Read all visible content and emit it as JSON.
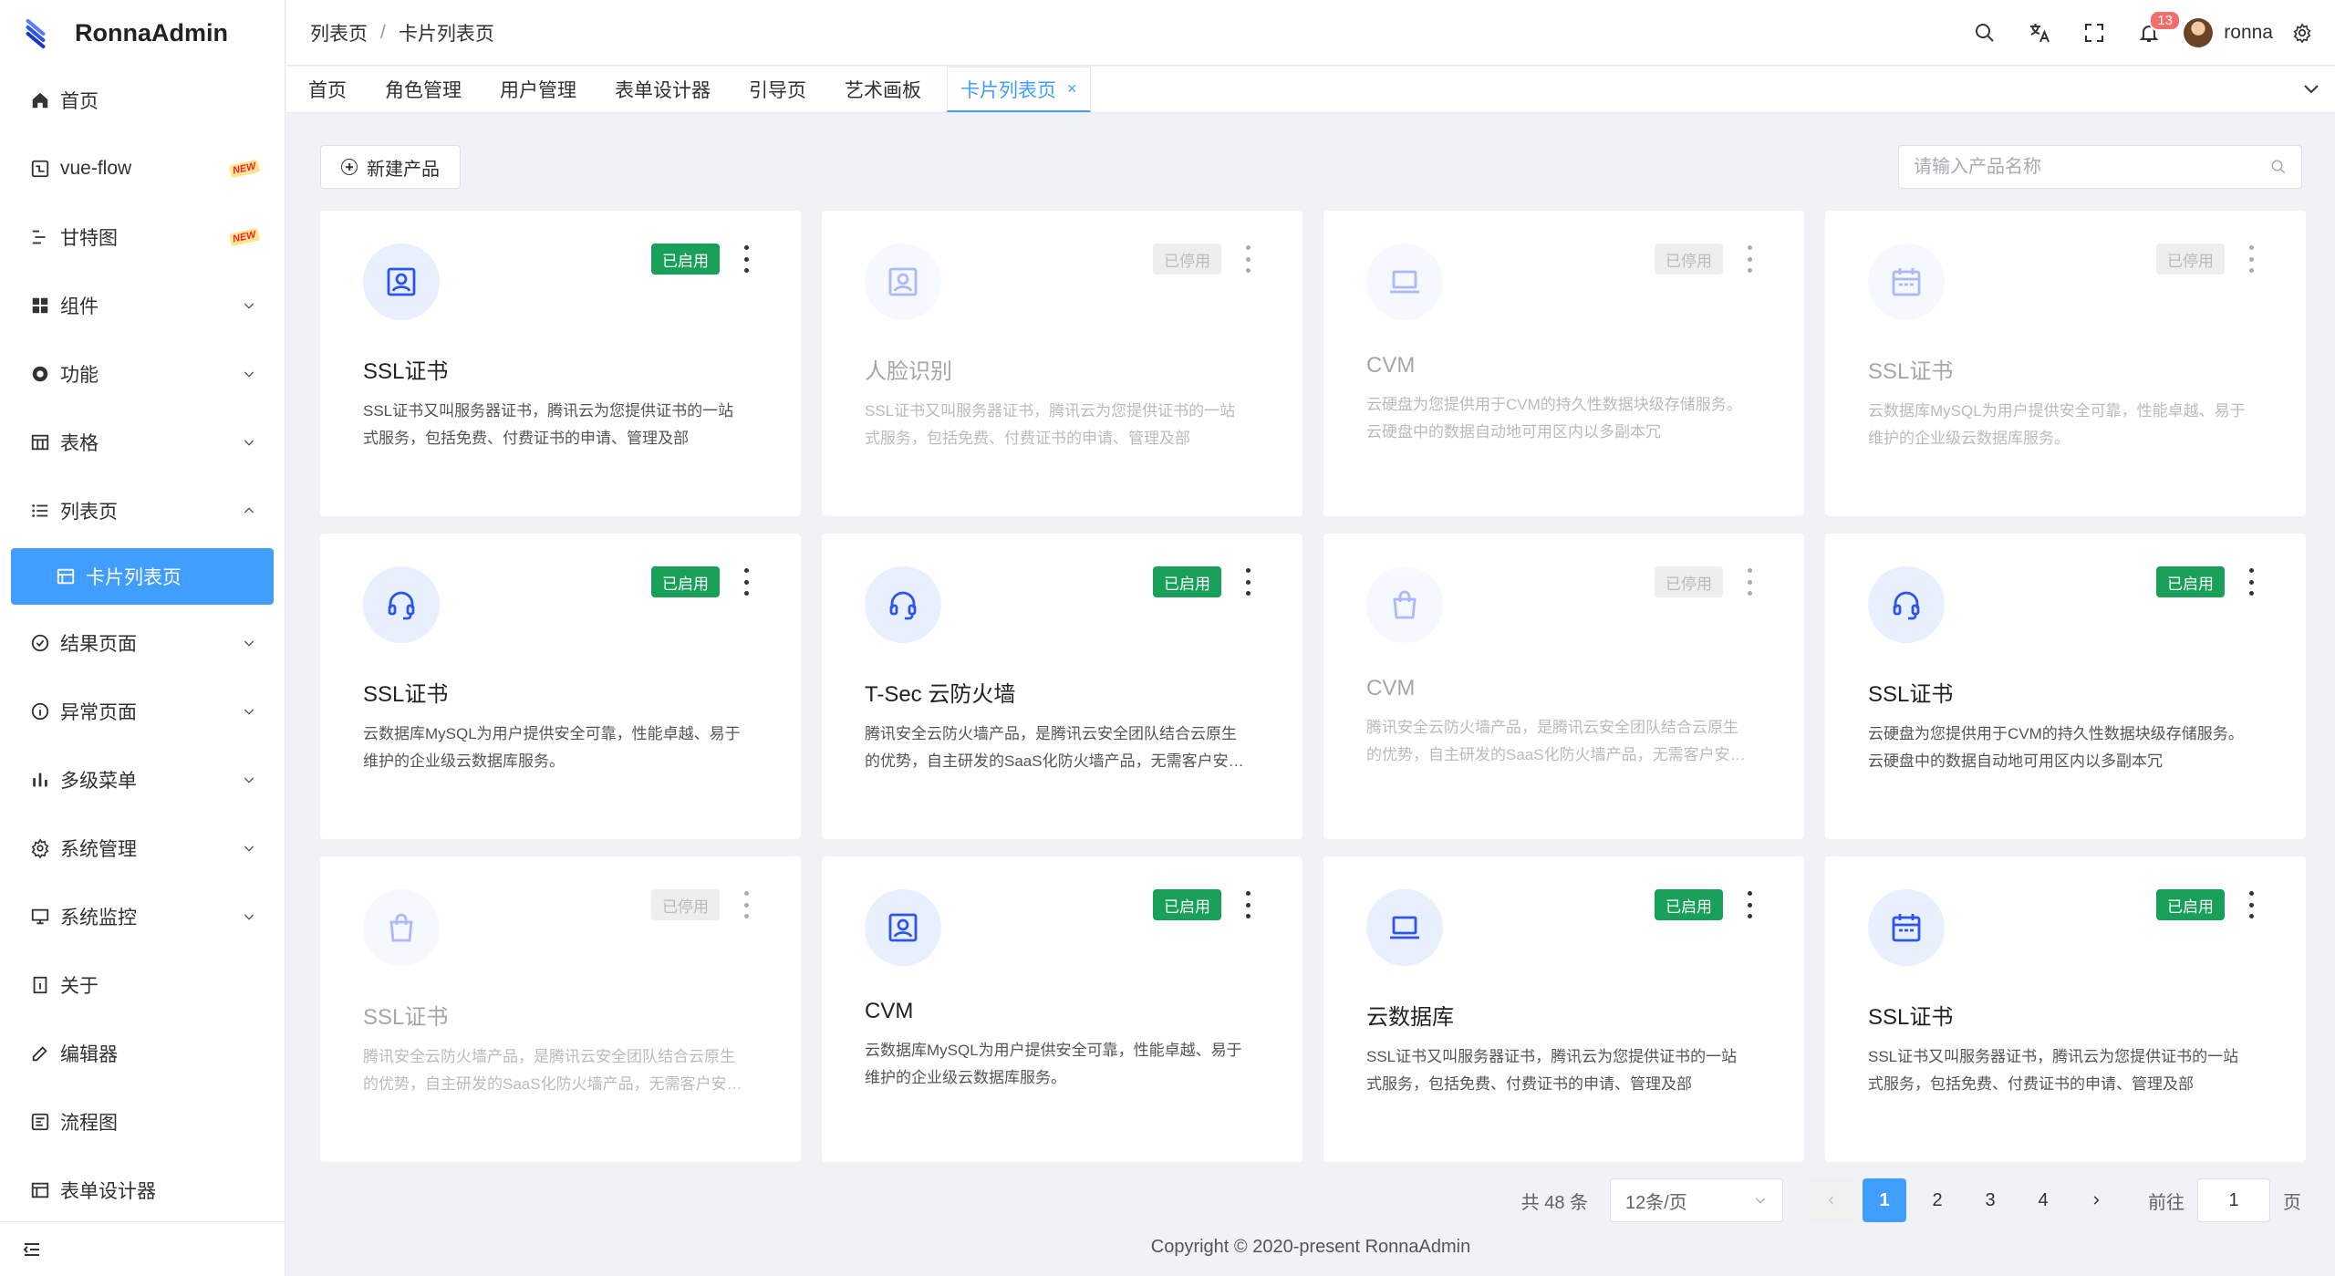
{
  "app": {
    "name": "RonnaAdmin"
  },
  "sidebar": {
    "items": [
      {
        "label": "首页",
        "icon": "home-icon",
        "arrow": ""
      },
      {
        "label": "vue-flow",
        "icon": "flow-icon",
        "badge": "NEW",
        "arrow": ""
      },
      {
        "label": "甘特图",
        "icon": "gantt-icon",
        "badge": "NEW",
        "arrow": ""
      },
      {
        "label": "组件",
        "icon": "grid-icon",
        "arrow": "down"
      },
      {
        "label": "功能",
        "icon": "function-icon",
        "arrow": "down"
      },
      {
        "label": "表格",
        "icon": "table-icon",
        "arrow": "down"
      },
      {
        "label": "列表页",
        "icon": "list-icon",
        "arrow": "up"
      },
      {
        "label": "卡片列表页",
        "icon": "card-icon",
        "active": true
      },
      {
        "label": "结果页面",
        "icon": "check-circle-icon",
        "arrow": "down"
      },
      {
        "label": "异常页面",
        "icon": "info-icon",
        "arrow": "down"
      },
      {
        "label": "多级菜单",
        "icon": "bar-chart-icon",
        "arrow": "down"
      },
      {
        "label": "系统管理",
        "icon": "settings-icon",
        "arrow": "down"
      },
      {
        "label": "系统监控",
        "icon": "monitor-icon",
        "arrow": "down"
      },
      {
        "label": "关于",
        "icon": "about-icon",
        "arrow": ""
      },
      {
        "label": "编辑器",
        "icon": "edit-icon",
        "arrow": ""
      },
      {
        "label": "流程图",
        "icon": "flowchart-icon",
        "arrow": ""
      },
      {
        "label": "表单设计器",
        "icon": "form-icon",
        "arrow": ""
      }
    ]
  },
  "header": {
    "breadcrumb": [
      "列表页",
      "卡片列表页"
    ],
    "notifications": "13",
    "username": "ronna"
  },
  "tabs": [
    {
      "label": "首页"
    },
    {
      "label": "角色管理"
    },
    {
      "label": "用户管理"
    },
    {
      "label": "表单设计器"
    },
    {
      "label": "引导页"
    },
    {
      "label": "艺术画板"
    },
    {
      "label": "卡片列表页",
      "active": true
    }
  ],
  "toolbar": {
    "new_label": "新建产品",
    "search_placeholder": "请输入产品名称"
  },
  "cards": [
    {
      "title": "SSL证书",
      "desc": "SSL证书又叫服务器证书，腾讯云为您提供证书的一站式服务，包括免费、付费证书的申请、管理及部",
      "status": "已启用",
      "enabled": true,
      "icon": "person-card-icon"
    },
    {
      "title": "人脸识别",
      "desc": "SSL证书又叫服务器证书，腾讯云为您提供证书的一站式服务，包括免费、付费证书的申请、管理及部",
      "status": "已停用",
      "enabled": false,
      "icon": "person-card-icon"
    },
    {
      "title": "CVM",
      "desc": "云硬盘为您提供用于CVM的持久性数据块级存储服务。云硬盘中的数据自动地可用区内以多副本冗",
      "status": "已停用",
      "enabled": false,
      "icon": "laptop-icon"
    },
    {
      "title": "SSL证书",
      "desc": "云数据库MySQL为用户提供安全可靠，性能卓越、易于维护的企业级云数据库服务。",
      "status": "已停用",
      "enabled": false,
      "icon": "calendar-icon"
    },
    {
      "title": "SSL证书",
      "desc": "云数据库MySQL为用户提供安全可靠，性能卓越、易于维护的企业级云数据库服务。",
      "status": "已启用",
      "enabled": true,
      "icon": "headset-icon"
    },
    {
      "title": "T-Sec 云防火墙",
      "desc": "腾讯安全云防火墙产品，是腾讯云安全团队结合云原生的优势，自主研发的SaaS化防火墙产品，无需客户安装部署",
      "status": "已启用",
      "enabled": true,
      "icon": "headset-icon"
    },
    {
      "title": "CVM",
      "desc": "腾讯安全云防火墙产品，是腾讯云安全团队结合云原生的优势，自主研发的SaaS化防火墙产品，无需客户安装部署",
      "status": "已停用",
      "enabled": false,
      "icon": "shopping-bag-icon"
    },
    {
      "title": "SSL证书",
      "desc": "云硬盘为您提供用于CVM的持久性数据块级存储服务。云硬盘中的数据自动地可用区内以多副本冗",
      "status": "已启用",
      "enabled": true,
      "icon": "headset-icon"
    },
    {
      "title": "SSL证书",
      "desc": "腾讯安全云防火墙产品，是腾讯云安全团队结合云原生的优势，自主研发的SaaS化防火墙产品，无需客户安装部署",
      "status": "已停用",
      "enabled": false,
      "icon": "shopping-bag-icon"
    },
    {
      "title": "CVM",
      "desc": "云数据库MySQL为用户提供安全可靠，性能卓越、易于维护的企业级云数据库服务。",
      "status": "已启用",
      "enabled": true,
      "icon": "person-card-icon"
    },
    {
      "title": "云数据库",
      "desc": "SSL证书又叫服务器证书，腾讯云为您提供证书的一站式服务，包括免费、付费证书的申请、管理及部",
      "status": "已启用",
      "enabled": true,
      "icon": "laptop-icon"
    },
    {
      "title": "SSL证书",
      "desc": "SSL证书又叫服务器证书，腾讯云为您提供证书的一站式服务，包括免费、付费证书的申请、管理及部",
      "status": "已启用",
      "enabled": true,
      "icon": "calendar-icon"
    }
  ],
  "pagination": {
    "total": "共 48 条",
    "page_size": "12条/页",
    "pages": [
      "1",
      "2",
      "3",
      "4"
    ],
    "current": "1",
    "goto_label": "前往",
    "goto_value": "1",
    "page_unit": "页"
  },
  "footer": {
    "copyright": "Copyright © 2020-present RonnaAdmin"
  },
  "colors": {
    "primary": "#409eff",
    "enabled": "#18a058",
    "icon_bg": "#e8f0fe",
    "icon_fg": "#2f54eb"
  }
}
